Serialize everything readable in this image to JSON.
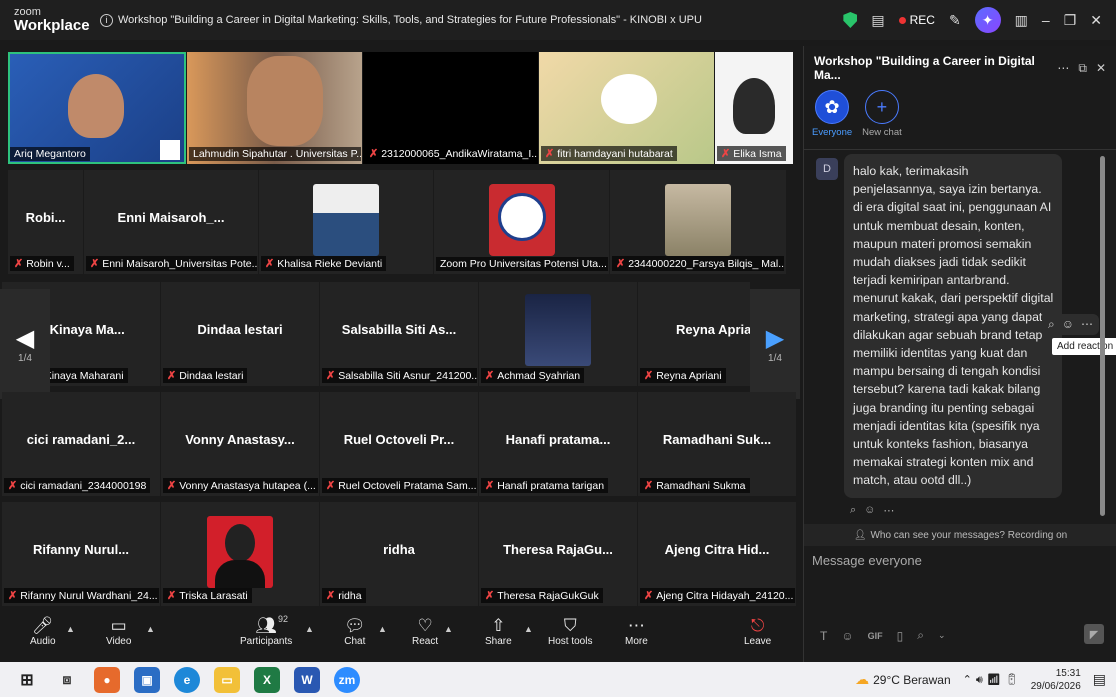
{
  "app": {
    "logo_top": "zoom",
    "logo_bottom": "Workplace",
    "title": "Workshop \"Building a Career in Digital Marketing: Skills, Tools,  and Strategies for Future Professionals\" - KINOBI x UPU",
    "rec": "REC"
  },
  "grid": {
    "row1": [
      {
        "label": "Ariq Megantoro"
      },
      {
        "label": "Lahmudin Sipahutar . Universitas P..."
      },
      {
        "label": "2312000065_AndikaWiratama_I..."
      },
      {
        "label": "fitri hamdayani hutabarat"
      },
      {
        "label": "Elika Isma"
      }
    ],
    "row2": [
      {
        "name": "Robi...",
        "label": "Robin v..."
      },
      {
        "name": "Enni  Maisaroh_...",
        "label": "Enni Maisaroh_Universitas Pote..."
      },
      {
        "name": "",
        "label": "Khalisa Rieke Devianti"
      },
      {
        "name": "",
        "label": "Zoom Pro Universitas Potensi Uta..."
      },
      {
        "name": "",
        "label": "2344000220_Farsya Bilqis_ Mal..."
      }
    ],
    "row3": [
      {
        "name": "ri Kinaya Ma...",
        "label": "Putri Kinaya Maharani"
      },
      {
        "name": "Dindaa lestari",
        "label": "Dindaa lestari"
      },
      {
        "name": "Salsabilla Siti As...",
        "label": "Salsabilla Siti Asnur_241200..."
      },
      {
        "name": "",
        "label": "Achmad Syahrian"
      },
      {
        "name": "Reyna Apriani",
        "label": "Reyna Apriani"
      }
    ],
    "row4": [
      {
        "name": "cici  ramadani_2...",
        "label": "cici ramadani_2344000198"
      },
      {
        "name": "Vonny Anastasy...",
        "label": "Vonny Anastasya hutapea (..."
      },
      {
        "name": "Ruel Octoveli Pr...",
        "label": "Ruel Octoveli Pratama Sam..."
      },
      {
        "name": "Hanafi pratama...",
        "label": "Hanafi pratama tarigan"
      },
      {
        "name": "Ramadhani Suk...",
        "label": "Ramadhani Sukma"
      }
    ],
    "row5": [
      {
        "name": "Rifanny Nurul...",
        "label": "Rifanny Nurul Wardhani_24..."
      },
      {
        "name": "",
        "label": "Triska Larasati"
      },
      {
        "name": "ridha",
        "label": "ridha"
      },
      {
        "name": "Theresa RajaGu...",
        "label": "Theresa RajaGukGuk"
      },
      {
        "name": "Ajeng Citra Hid...",
        "label": "Ajeng Citra Hidayah_24120..."
      }
    ],
    "page_left": "1/4",
    "page_right": "1/4"
  },
  "toolbar": {
    "audio": "Audio",
    "video": "Video",
    "participants": "Participants",
    "participants_count": "92",
    "chat": "Chat",
    "react": "React",
    "share": "Share",
    "host_tools": "Host tools",
    "more": "More",
    "leave": "Leave"
  },
  "chat": {
    "title": "Workshop \"Building a Career in Digital Ma...",
    "tab_everyone": "Everyone",
    "tab_new": "New chat",
    "sender_initial": "D",
    "message": "halo kak, terimakasih penjelasannya, saya izin bertanya. di era digital saat ini, penggunaan AI untuk membuat desain, konten, maupun materi promosi semakin mudah diakses jadi tidak sedikit terjadi kemiripan antarbrand. menurut kakak, dari perspektif digital marketing, strategi apa yang dapat dilakukan agar sebuah brand tetap memiliki identitas yang kuat dan mampu bersaing di tengah kondisi tersebut? karena tadi kakak bilang juga branding itu penting sebagai menjadi identitas kita (spesifik nya untuk konteks fashion, biasanya memakai strategi konten mix and match, atau ootd dll..)",
    "tooltip": "Add reaction",
    "who_can_see": "Who can see your messages? Recording on",
    "placeholder": "Message everyone"
  },
  "taskbar": {
    "weather": "29°C  Berawan",
    "time": "15:31",
    "date": "29/06/2026"
  }
}
